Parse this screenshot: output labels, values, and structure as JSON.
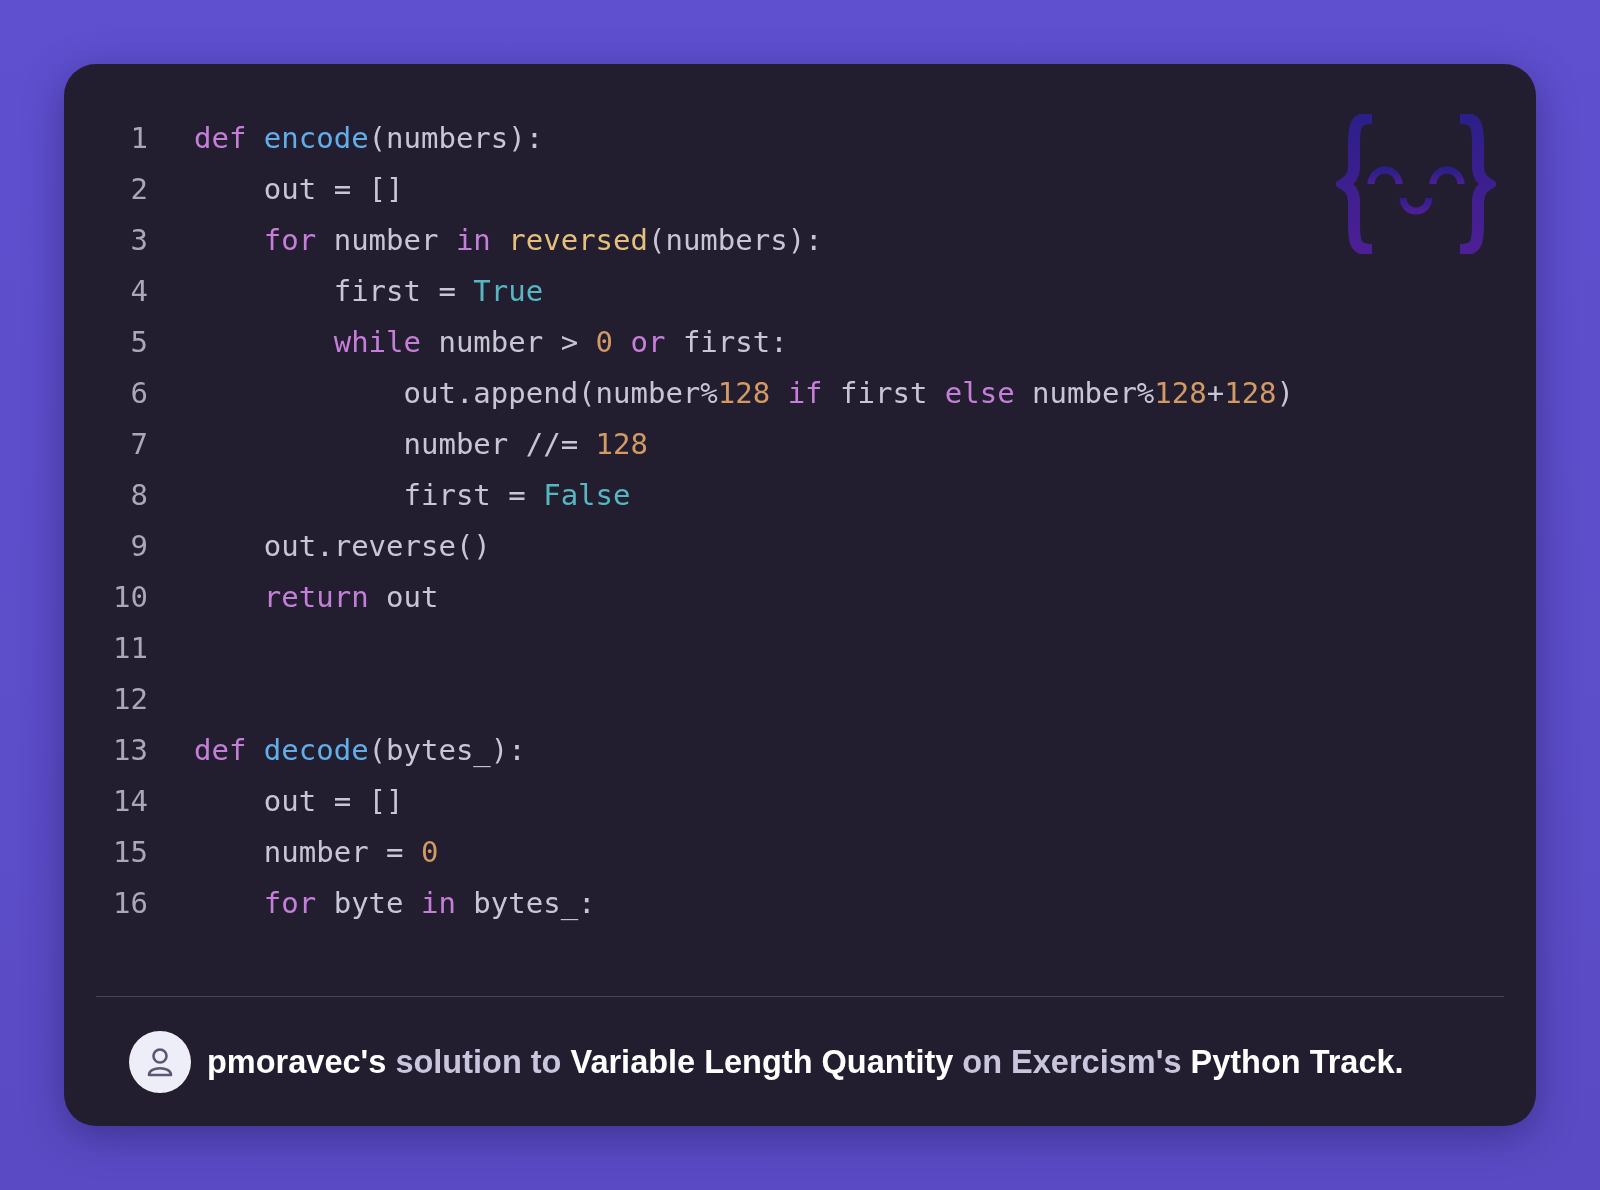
{
  "code_lines": [
    {
      "number": "1",
      "tokens": [
        {
          "kind": "keyword",
          "text": "def"
        },
        {
          "kind": "function",
          "text": " encode"
        },
        {
          "kind": "plain",
          "text": "(numbers):"
        }
      ]
    },
    {
      "number": "2",
      "tokens": [
        {
          "kind": "plain",
          "text": "    out = []"
        }
      ]
    },
    {
      "number": "3",
      "tokens": [
        {
          "kind": "keyword",
          "text": "    for"
        },
        {
          "kind": "plain",
          "text": " number "
        },
        {
          "kind": "keyword",
          "text": "in"
        },
        {
          "kind": "builtin",
          "text": " reversed"
        },
        {
          "kind": "plain",
          "text": "(numbers):"
        }
      ]
    },
    {
      "number": "4",
      "tokens": [
        {
          "kind": "plain",
          "text": "        first = "
        },
        {
          "kind": "constant",
          "text": "True"
        }
      ]
    },
    {
      "number": "5",
      "tokens": [
        {
          "kind": "keyword",
          "text": "        while"
        },
        {
          "kind": "plain",
          "text": " number > "
        },
        {
          "kind": "number",
          "text": "0"
        },
        {
          "kind": "keyword",
          "text": " or"
        },
        {
          "kind": "plain",
          "text": " first:"
        }
      ]
    },
    {
      "number": "6",
      "tokens": [
        {
          "kind": "plain",
          "text": "            out.append(number%"
        },
        {
          "kind": "number",
          "text": "128"
        },
        {
          "kind": "keyword",
          "text": " if"
        },
        {
          "kind": "plain",
          "text": " first "
        },
        {
          "kind": "keyword",
          "text": "else"
        },
        {
          "kind": "plain",
          "text": " number%"
        },
        {
          "kind": "number",
          "text": "128"
        },
        {
          "kind": "plain",
          "text": "+"
        },
        {
          "kind": "number",
          "text": "128"
        },
        {
          "kind": "plain",
          "text": ")"
        }
      ]
    },
    {
      "number": "7",
      "tokens": [
        {
          "kind": "plain",
          "text": "            number //= "
        },
        {
          "kind": "number",
          "text": "128"
        }
      ]
    },
    {
      "number": "8",
      "tokens": [
        {
          "kind": "plain",
          "text": "            first = "
        },
        {
          "kind": "constant",
          "text": "False"
        }
      ]
    },
    {
      "number": "9",
      "tokens": [
        {
          "kind": "plain",
          "text": "    out.reverse()"
        }
      ]
    },
    {
      "number": "10",
      "tokens": [
        {
          "kind": "keyword",
          "text": "    return"
        },
        {
          "kind": "plain",
          "text": " out"
        }
      ]
    },
    {
      "number": "11"
    },
    {
      "number": "12"
    },
    {
      "number": "13",
      "tokens": [
        {
          "kind": "keyword",
          "text": "def"
        },
        {
          "kind": "function",
          "text": " decode"
        },
        {
          "kind": "plain",
          "text": "(bytes_):"
        }
      ]
    },
    {
      "number": "14",
      "tokens": [
        {
          "kind": "plain",
          "text": "    out = []"
        }
      ]
    },
    {
      "number": "15",
      "tokens": [
        {
          "kind": "plain",
          "text": "    number = "
        },
        {
          "kind": "number",
          "text": "0"
        }
      ]
    },
    {
      "number": "16",
      "tokens": [
        {
          "kind": "keyword",
          "text": "    for"
        },
        {
          "kind": "plain",
          "text": " byte "
        },
        {
          "kind": "keyword",
          "text": "in"
        },
        {
          "kind": "plain",
          "text": " bytes_:"
        }
      ]
    }
  ],
  "footer": {
    "caption": "**pmoravec's** solution to **Variable Length Quantity** on Exercism's **Python Track.**"
  }
}
